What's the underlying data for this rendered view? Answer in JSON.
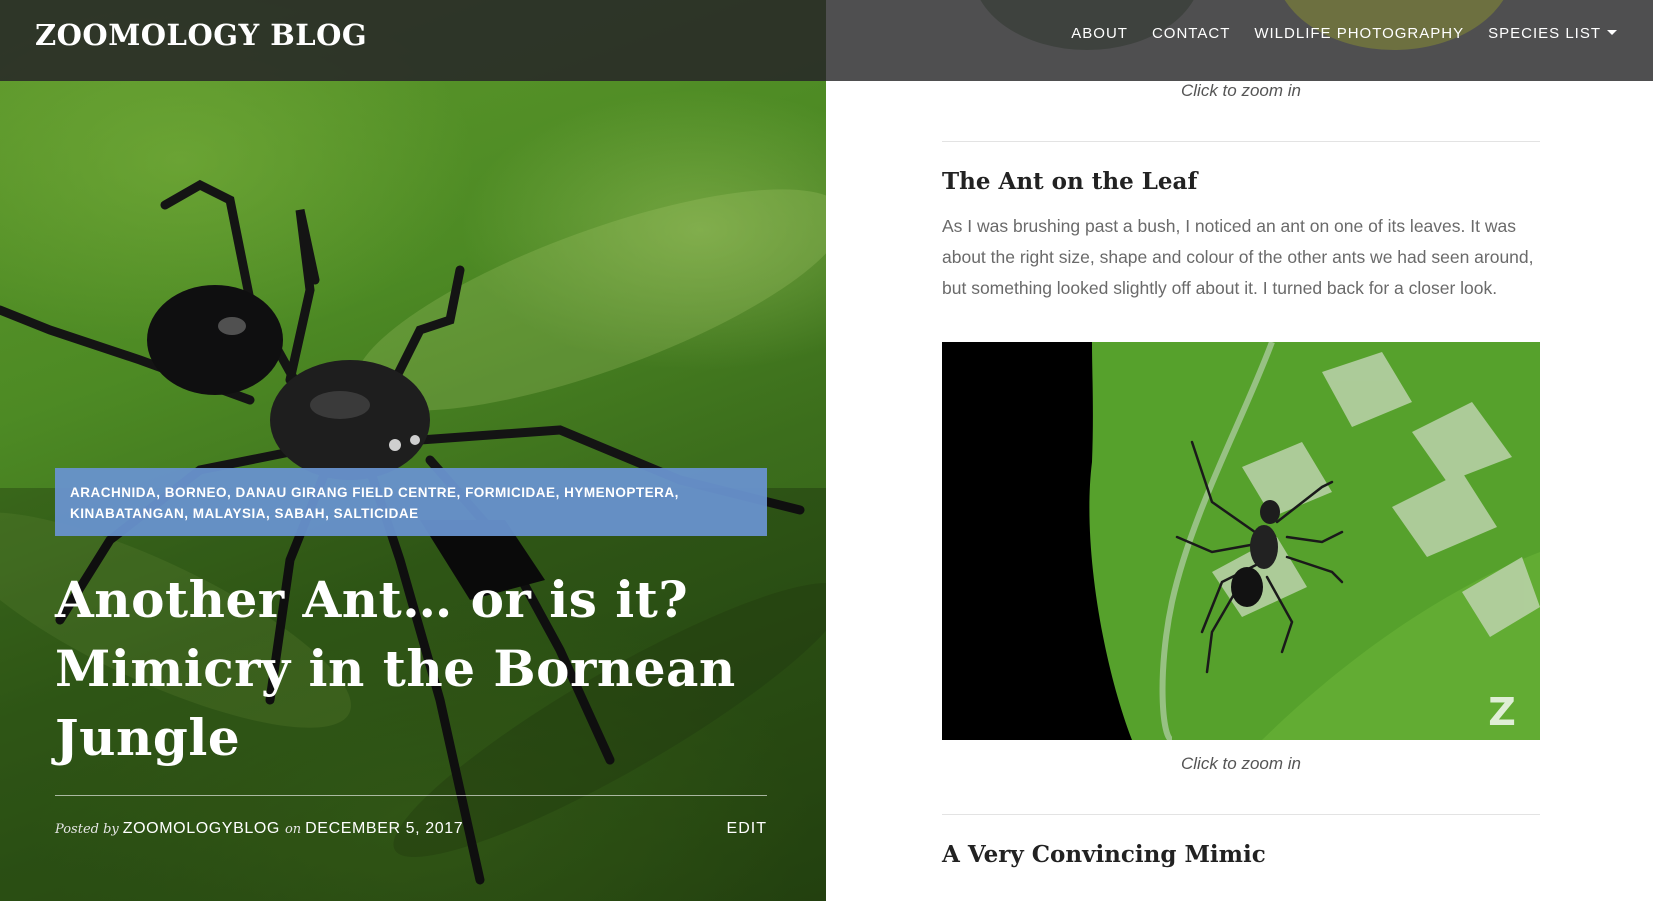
{
  "site": {
    "title": "ZOOMOLOGY BLOG"
  },
  "nav": {
    "items": [
      {
        "label": "ABOUT"
      },
      {
        "label": "CONTACT"
      },
      {
        "label": "WILDLIFE PHOTOGRAPHY"
      },
      {
        "label": "SPECIES LIST"
      }
    ]
  },
  "post": {
    "categories": [
      "ARACHNIDA",
      "BORNEO",
      "DANAU GIRANG FIELD CENTRE",
      "FORMICIDAE",
      "HYMENOPTERA",
      "KINABATANGAN",
      "MALAYSIA",
      "SABAH",
      "SALTICIDAE"
    ],
    "title_line1": "Another Ant… or is it?",
    "title_line2": "Mimicry in the Bornean",
    "title_line3": "Jungle",
    "posted_by_label": "Posted by",
    "author": "ZOOMOLOGYBLOG",
    "on_label": "on",
    "date": "DECEMBER 5, 2017",
    "edit_label": "EDIT"
  },
  "content": {
    "top_caption": "Click to zoom in",
    "section1_heading": "The Ant on the Leaf",
    "section1_line1": "As I was brushing past a bush, I noticed an ant on one of its leaves. It was",
    "section1_line2": "about the right size, shape and colour of the other ants we had seen around,",
    "section1_line3": "but something looked slightly off about it. I turned back for a closer look.",
    "photo_caption": "Click to zoom in",
    "section2_heading": "A Very Convincing Mimic"
  },
  "colors": {
    "category_bg": "#6892ce",
    "topbar": "#2b2b2b",
    "accent_text": "#222222"
  },
  "icons": {
    "dropdown": "caret-down-icon",
    "watermark": "z-logo-watermark"
  }
}
